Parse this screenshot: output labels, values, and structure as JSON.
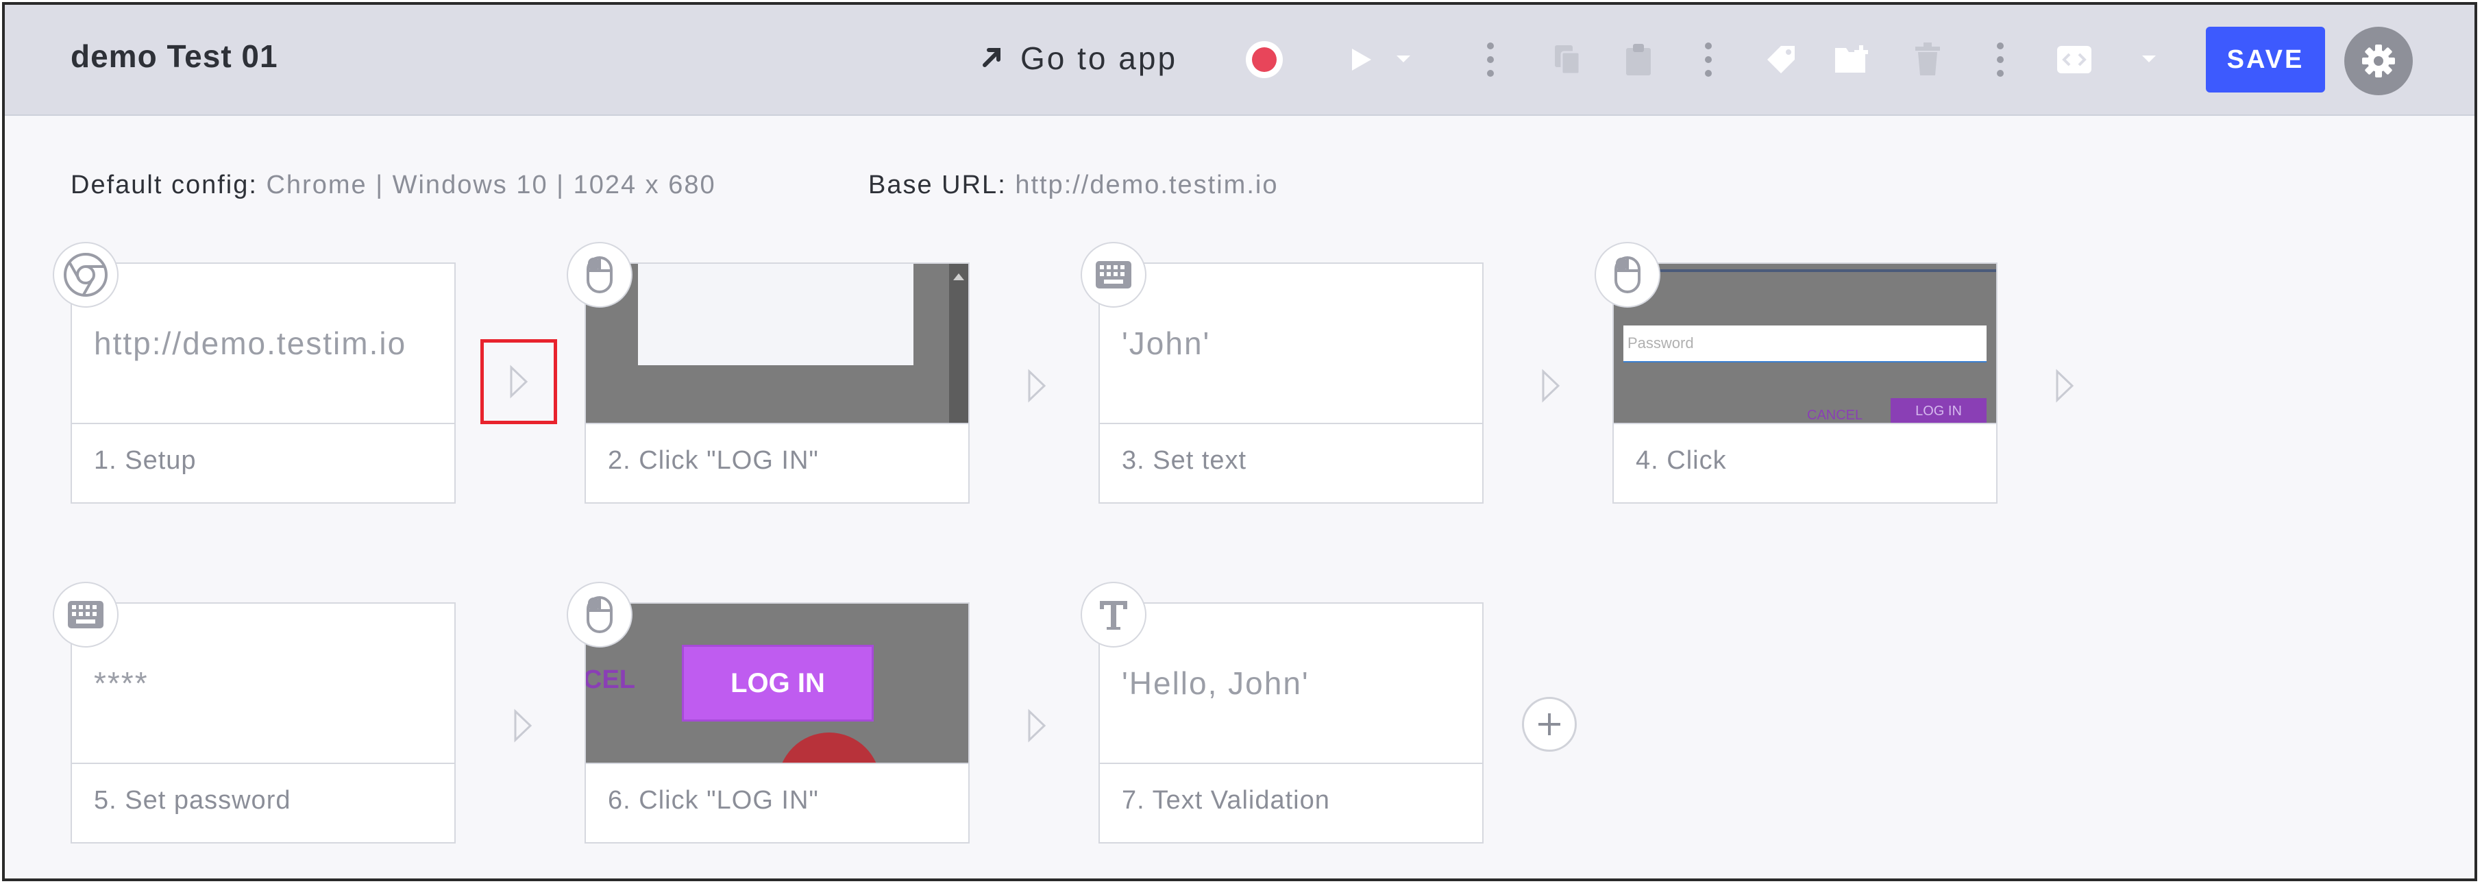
{
  "header": {
    "test_name": "demo Test 01",
    "go_to_app": "Go to app",
    "save_label": "SAVE",
    "record_color": "#e8455a",
    "save_color": "#3d5afe",
    "icons": [
      "external-link-icon",
      "record-icon",
      "play-icon",
      "dropdown-icon",
      "more-vertical-icon",
      "copy-icon",
      "paste-icon",
      "more-vertical-icon",
      "tag-icon",
      "add-folder-icon",
      "trash-icon",
      "more-vertical-icon",
      "code-icon",
      "dropdown-icon",
      "gear-icon"
    ]
  },
  "config": {
    "default_label": "Default config:",
    "default_value": "Chrome | Windows 10 | 1024 x 680",
    "base_url_label": "Base URL:",
    "base_url_value": "http://demo.testim.io"
  },
  "steps": [
    {
      "label": "1. Setup",
      "value": "http://demo.testim.io",
      "icon": "chrome-icon"
    },
    {
      "label": "2. Click \"LOG IN\"",
      "value": "",
      "icon": "mouse-icon"
    },
    {
      "label": "3. Set text",
      "value": "'John'",
      "icon": "keyboard-icon"
    },
    {
      "label": "4. Click",
      "value": "",
      "icon": "mouse-icon",
      "thumb": {
        "placeholder": "Password",
        "cancel": "CANCEL",
        "login": "LOG IN"
      }
    },
    {
      "label": "5. Set password",
      "value": "****",
      "icon": "keyboard-icon"
    },
    {
      "label": "6. Click \"LOG IN\"",
      "value": "",
      "icon": "mouse-icon",
      "thumb": {
        "left_text": "CEL",
        "button": "LOG IN"
      }
    },
    {
      "label": "7. Text Validation",
      "value": "'Hello, John'",
      "icon": "text-icon"
    }
  ],
  "accent": {
    "highlight": "#e8232d",
    "login_purple": "#bf5cf0"
  }
}
